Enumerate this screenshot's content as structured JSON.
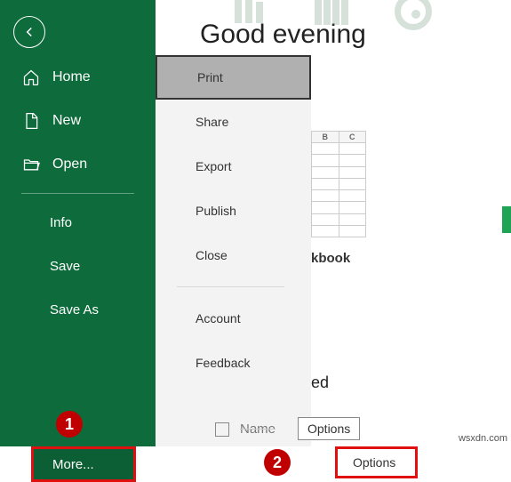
{
  "greeting": "Good evening",
  "sidebar": {
    "home": "Home",
    "new": "New",
    "open": "Open",
    "info": "Info",
    "save": "Save",
    "saveas": "Save As",
    "more": "More..."
  },
  "submenu": {
    "print": "Print",
    "share": "Share",
    "export": "Export",
    "publish": "Publish",
    "close": "Close",
    "account": "Account",
    "feedback": "Feedback",
    "options": "Options"
  },
  "content": {
    "col_b": "B",
    "col_c": "C",
    "workbook_label": "kbook",
    "ed_text": "ed",
    "name_label": "Name",
    "options_tip": "Options"
  },
  "badges": {
    "one": "1",
    "two": "2"
  },
  "watermark": "wsxdn.com",
  "colors": {
    "brand": "#0e6b3c",
    "highlight": "#e01010",
    "badge": "#c00000"
  }
}
